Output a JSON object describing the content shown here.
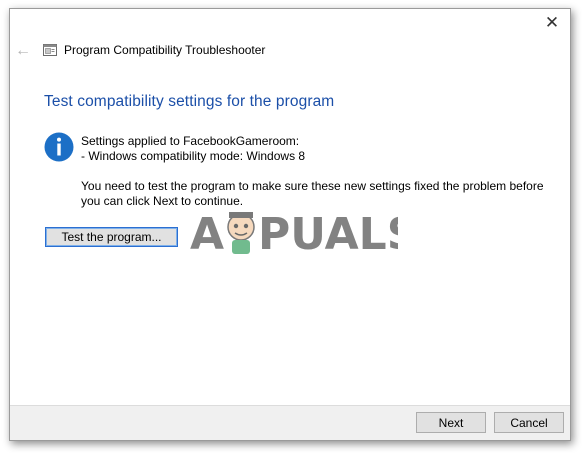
{
  "window": {
    "title": "Program Compatibility Troubleshooter",
    "close_glyph": "✕",
    "back_glyph": "←"
  },
  "main": {
    "heading": "Test compatibility settings for the program",
    "settings_applied": "Settings applied to FacebookGameroom:",
    "compat_mode": "- Windows compatibility mode: Windows 8",
    "test_message": "You need to test the program to make sure these new settings fixed the problem before you can click Next to continue.",
    "test_button": "Test the program..."
  },
  "footer": {
    "next_label": "Next",
    "cancel_label": "Cancel"
  },
  "icons": {
    "info": "info-icon",
    "app": "troubleshooter-app-icon",
    "back": "back-arrow-icon",
    "close": "close-icon"
  },
  "colors": {
    "heading": "#1b4fa8",
    "info_circle": "#1c6fc6",
    "button_focus_border": "#2c6fd1"
  },
  "watermark": {
    "text": "APPUALS"
  }
}
